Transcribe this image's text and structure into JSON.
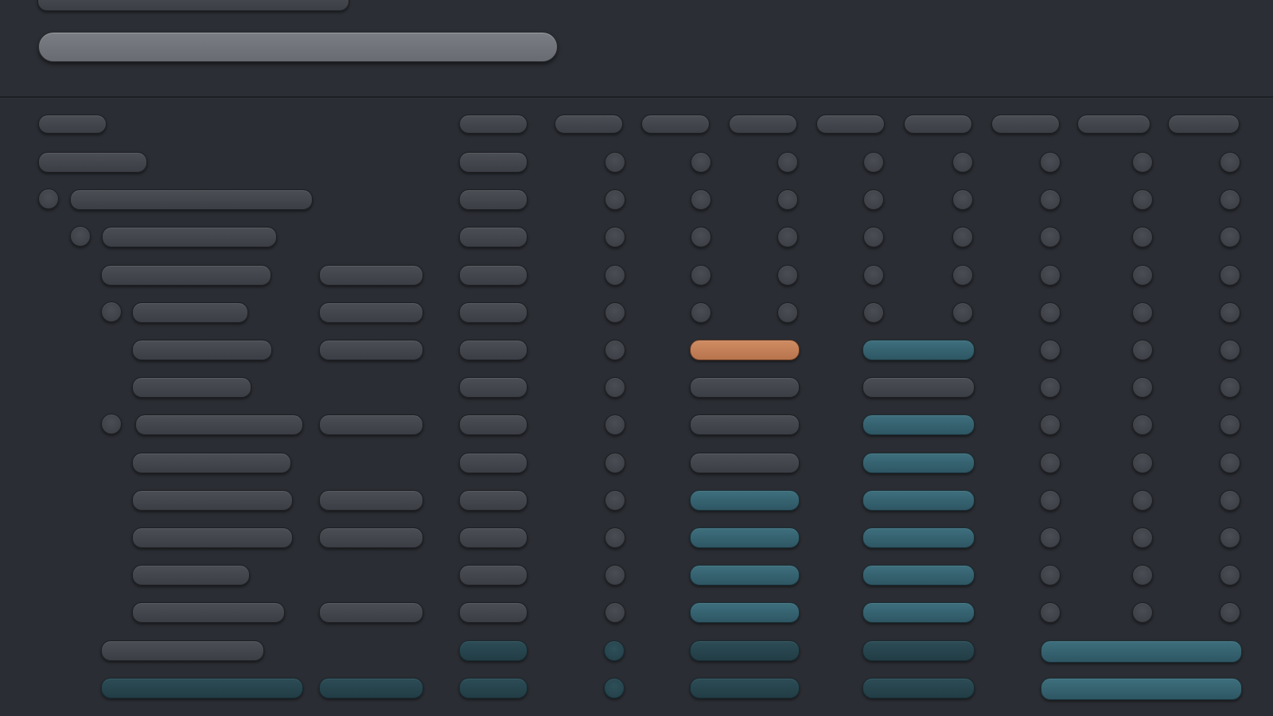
{
  "colors": {
    "background": "#2a2d33",
    "pill_neutral": "#43464d",
    "pill_teal": "#36636f",
    "pill_teal_dark": "#27444d",
    "pill_orange": "#c47f57",
    "search_field": "#72767c"
  },
  "header": {
    "title_text": "",
    "search_placeholder": ""
  },
  "columns": [
    {
      "key": "c1",
      "label": ""
    },
    {
      "key": "c2",
      "label": ""
    },
    {
      "key": "c3",
      "label": ""
    },
    {
      "key": "c4",
      "label": ""
    },
    {
      "key": "c5",
      "label": ""
    },
    {
      "key": "c6",
      "label": ""
    },
    {
      "key": "c7",
      "label": ""
    },
    {
      "key": "c8",
      "label": ""
    },
    {
      "key": "c9",
      "label": ""
    },
    {
      "key": "c10",
      "label": ""
    }
  ],
  "rows": [
    {
      "label": "",
      "indent": 0,
      "expander": false
    },
    {
      "label": "",
      "indent": 0,
      "expander": false
    },
    {
      "label": "",
      "indent": 0,
      "expander": true
    },
    {
      "label": "",
      "indent": 1,
      "expander": true
    },
    {
      "label": "",
      "indent": 2,
      "expander": false
    },
    {
      "label": "",
      "indent": 2,
      "expander": true
    },
    {
      "label": "",
      "indent": 3,
      "expander": false,
      "highlight": "orange"
    },
    {
      "label": "",
      "indent": 3,
      "expander": false
    },
    {
      "label": "",
      "indent": 2,
      "expander": true
    },
    {
      "label": "",
      "indent": 3,
      "expander": false
    },
    {
      "label": "",
      "indent": 3,
      "expander": false
    },
    {
      "label": "",
      "indent": 3,
      "expander": false
    },
    {
      "label": "",
      "indent": 3,
      "expander": false
    },
    {
      "label": "",
      "indent": 3,
      "expander": false
    },
    {
      "label": "",
      "indent": 2,
      "expander": false
    },
    {
      "label": "",
      "indent": 2,
      "expander": false
    }
  ]
}
